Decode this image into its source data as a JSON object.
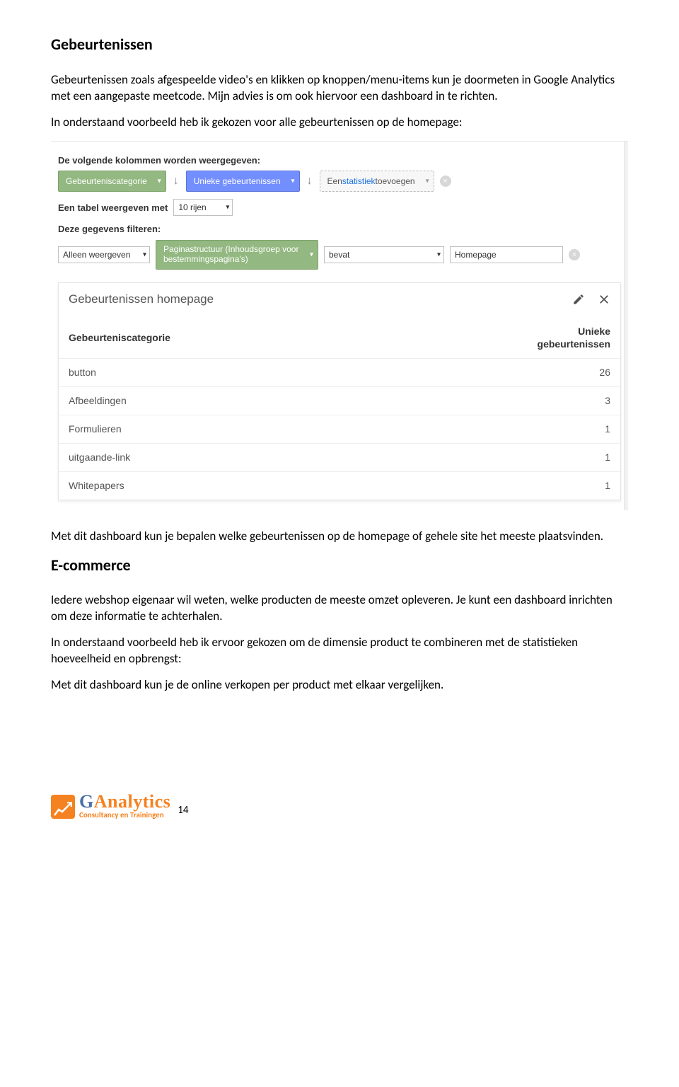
{
  "section1": {
    "heading": "Gebeurtenissen",
    "p1": "Gebeurtenissen zoals afgespeelde video's en klikken op knoppen/menu-items kun je doormeten in Google Analytics met een aangepaste meetcode. Mijn advies is om ook hiervoor een dashboard in te richten.",
    "p2": "In onderstaand voorbeeld heb ik gekozen voor alle gebeurtenissen op de homepage:"
  },
  "config": {
    "columns_label": "De volgende kolommen worden weergegeven:",
    "col1": "Gebeurteniscategorie",
    "col2": "Unieke gebeurtenissen",
    "col_add_prefix": "Een ",
    "col_add_link": "statistiek",
    "col_add_suffix": " toevoegen",
    "rows_label_pre": "Een tabel weergeven met",
    "rows_value": "10 rijen",
    "filter_label": "Deze gegevens filteren:",
    "filter_mode": "Alleen weergeven",
    "filter_dim": "Paginastructuur (Inhoudsgroep voor bestemmingspagina's)",
    "filter_op": "bevat",
    "filter_val": "Homepage"
  },
  "card": {
    "title": "Gebeurtenissen homepage",
    "th1": "Gebeurteniscategorie",
    "th2a": "Unieke",
    "th2b": "gebeurtenissen",
    "rows": [
      {
        "cat": "button",
        "val": "26"
      },
      {
        "cat": "Afbeeldingen",
        "val": "3"
      },
      {
        "cat": "Formulieren",
        "val": "1"
      },
      {
        "cat": "uitgaande-link",
        "val": "1"
      },
      {
        "cat": "Whitepapers",
        "val": "1"
      }
    ]
  },
  "after1": "Met dit dashboard kun je bepalen welke gebeurtenissen op de homepage of gehele site het meeste plaatsvinden.",
  "section2": {
    "heading": "E-commerce",
    "p1": "Iedere webshop eigenaar wil weten, welke producten de meeste omzet opleveren. Je kunt een dashboard inrichten om deze informatie te achterhalen.",
    "p2": "In onderstaand voorbeeld heb ik ervoor gekozen om de dimensie product te combineren met de statistieken hoeveelheid en opbrengst:",
    "p3": "Met dit dashboard kun je de online verkopen per product met elkaar vergelijken."
  },
  "footer": {
    "brand_g": "G",
    "brand_rest": "Analytics",
    "tagline": "Consultancy en Trainingen",
    "page": "14"
  }
}
